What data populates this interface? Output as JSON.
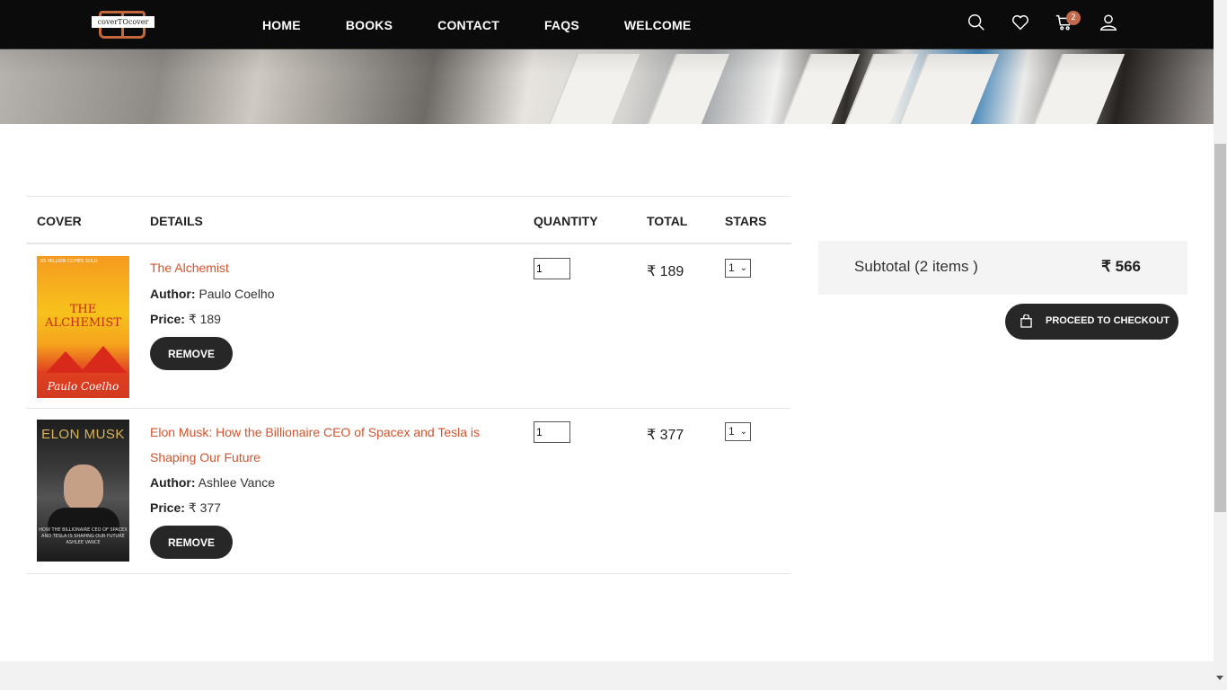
{
  "brand": {
    "logo_text": "coverTOcover"
  },
  "nav": {
    "links": [
      "HOME",
      "BOOKS",
      "CONTACT",
      "FAQS",
      "WELCOME"
    ],
    "icons": [
      "search-icon",
      "heart-icon",
      "cart-icon",
      "user-icon"
    ],
    "cart_count": "2"
  },
  "table": {
    "headers": {
      "cover": "COVER",
      "details": "DETAILS",
      "quantity": "QUANTITY",
      "total": "TOTAL",
      "stars": "STARS"
    },
    "author_label": "Author:",
    "price_label": "Price:",
    "remove_label": "REMOVE",
    "rows": [
      {
        "title": "The Alchemist",
        "author": "Paulo Coelho",
        "price": "₹ 189",
        "quantity": "1",
        "total": "₹ 189",
        "stars": "1",
        "cover_title": "THE ALCHEMIST",
        "cover_author": "Paulo Coelho",
        "cover_top": "65 MILLION COPIES SOLD"
      },
      {
        "title": "Elon Musk: How the Billionaire CEO of Spacex and Tesla is Shaping Our Future",
        "author": "Ashlee Vance",
        "price": "₹ 377",
        "quantity": "1",
        "total": "₹ 377",
        "stars": "1",
        "cover_title": "ELON MUSK",
        "cover_sub": "HOW THE BILLIONAIRE CEO OF SPACEX AND TESLA IS SHAPING OUR FUTURE",
        "cover_author": "ASHLEE VANCE"
      }
    ]
  },
  "summary": {
    "subtotal_label": "Subtotal (2 items )",
    "subtotal_value": "₹ 566",
    "checkout_label": "PROCEED TO CHECKOUT"
  },
  "colors": {
    "accent": "#d0552f",
    "badge": "#c36a4c",
    "nav_bg": "#0b0b0b",
    "button_bg": "#272727"
  }
}
